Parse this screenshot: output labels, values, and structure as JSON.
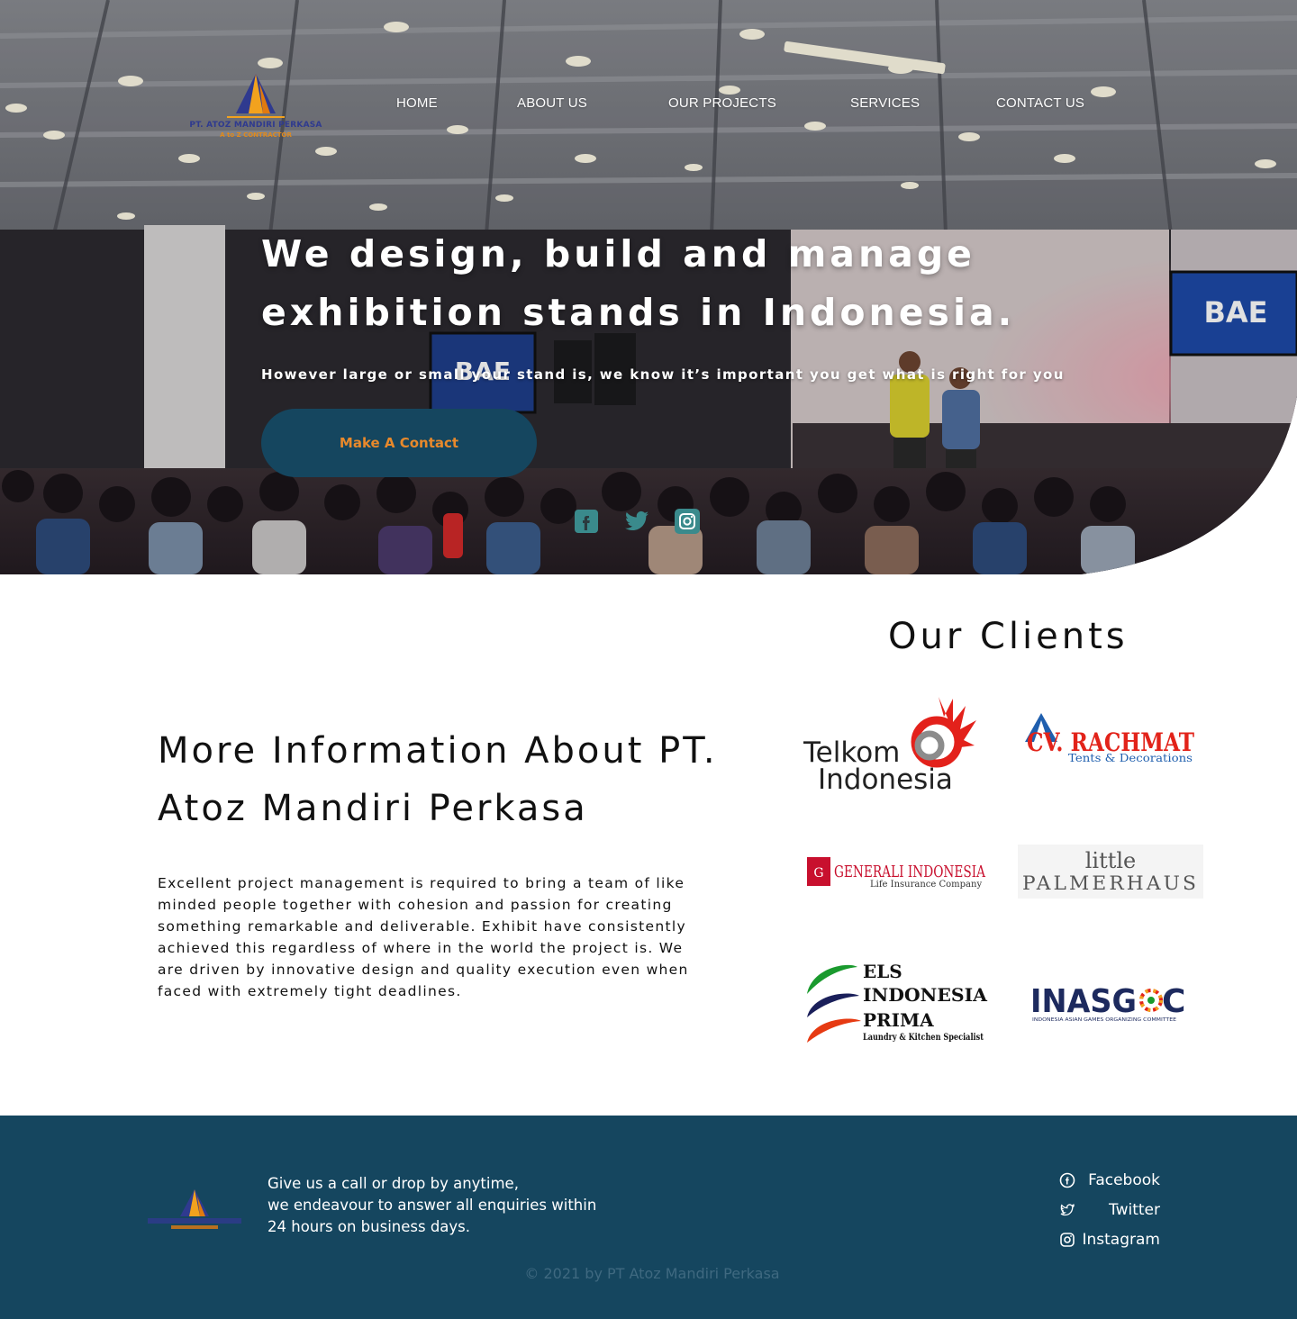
{
  "brand": {
    "logo_text": "PT. ATOZ MANDIRI PERKASA",
    "logo_sub": "A to Z CONTRACTOR"
  },
  "nav": {
    "items": [
      {
        "label": "HOME"
      },
      {
        "label": "ABOUT US"
      },
      {
        "label": "OUR PROJECTS"
      },
      {
        "label": "SERVICES"
      },
      {
        "label": "CONTACT US"
      }
    ]
  },
  "hero": {
    "title": "We design, build and manage exhibition stands in Indonesia.",
    "subtitle": "However large or small your stand is, we know it’s important you get what is right for you",
    "cta_label": "Make A Contact",
    "screen_text": "BAE",
    "social_icons": [
      "facebook-icon",
      "twitter-icon",
      "instagram-icon"
    ]
  },
  "clients": {
    "title": "Our Clients",
    "logos": [
      {
        "name": "telkom-logo",
        "line1": "Telkom",
        "line2": "Indonesia"
      },
      {
        "name": "rachmat-logo",
        "line1": "CV. RACHMAT",
        "line2": "Tents & Decorations"
      },
      {
        "name": "generali-logo",
        "line1": "GENERALI INDONESIA",
        "line2": "Life Insurance Company"
      },
      {
        "name": "palmerhaus-logo",
        "line1": "little",
        "line2": "PALMERHAUS"
      },
      {
        "name": "els-logo",
        "line1": "ELS",
        "line2": "INDONESIA",
        "line3": "PRIMA",
        "line4": "Laundry & Kitchen Specialist"
      },
      {
        "name": "inasgoc-logo",
        "line1": "INASG",
        "line1b": "C",
        "line2": "INDONESIA ASIAN GAMES ORGANIZING COMMITTEE"
      }
    ]
  },
  "info": {
    "title": "More Information About PT. Atoz Mandiri Perkasa",
    "body": "Excellent project management is required to bring a team of like minded people together with cohesion and passion for creating something remarkable and deliverable. Exhibit have consistently achieved this regardless of where in the world the project is. We are driven by innovative design and quality execution even when faced with extremely tight deadlines."
  },
  "footer": {
    "text_line1": "Give us a call or drop by anytime,",
    "text_line2": "we endeavour to answer all enquiries within",
    "text_line3": "24 hours on business days.",
    "social": [
      {
        "label": "Facebook",
        "icon": "facebook-icon"
      },
      {
        "label": "Twitter",
        "icon": "twitter-icon"
      },
      {
        "label": "Instagram",
        "icon": "instagram-icon"
      }
    ],
    "copyright": "© 2021 by PT Atoz Mandiri Perkasa"
  },
  "colors": {
    "primary": "#15465f",
    "accent": "#e8892b",
    "social_teal": "#3a8a8c"
  }
}
